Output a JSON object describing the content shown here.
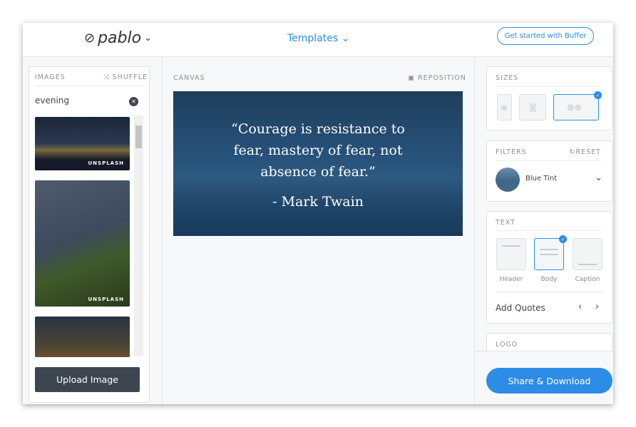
{
  "header": {
    "logo": "pablo",
    "templates": "Templates",
    "cta": "Get started with Buffer"
  },
  "images": {
    "title": "IMAGES",
    "shuffle": "SHUFFLE",
    "search_value": "evening",
    "credit": "UNSPLASH",
    "upload": "Upload Image"
  },
  "canvas": {
    "title": "CANVAS",
    "reposition": "REPOSITION",
    "quote": "“Courage is resistance to fear, mastery of fear, not absence of fear.”",
    "author": "- Mark Twain"
  },
  "sizes": {
    "title": "SIZES"
  },
  "filters": {
    "title": "FILTERS",
    "reset": "RESET",
    "selected": "Blue Tint"
  },
  "text": {
    "title": "TEXT",
    "options": [
      "Header",
      "Body",
      "Caption"
    ],
    "add_quotes": "Add Quotes"
  },
  "logo": {
    "title": "LOGO"
  },
  "share": "Share & Download",
  "colors": {
    "accent": "#2c8ce6",
    "upload_button": "#3d4650"
  }
}
